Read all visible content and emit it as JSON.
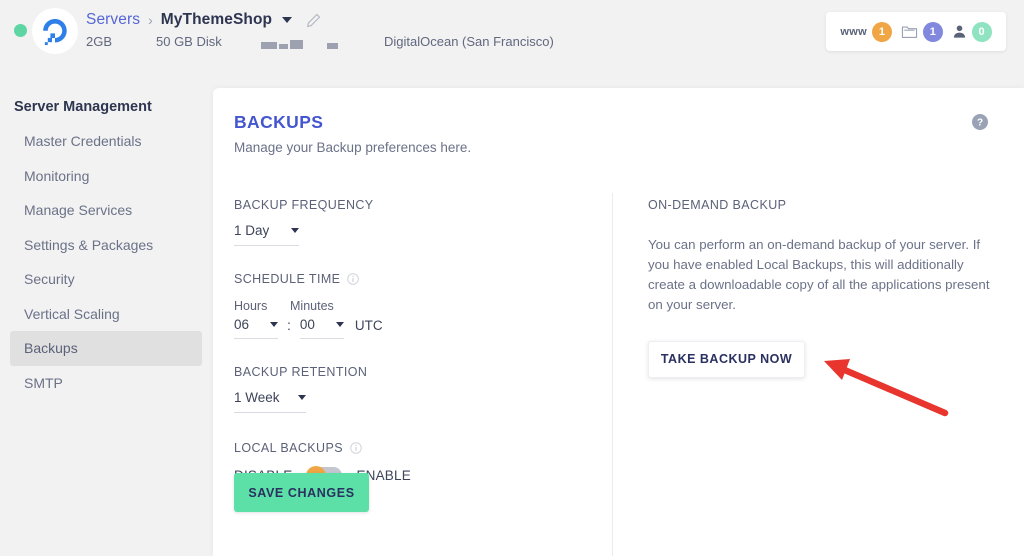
{
  "header": {
    "status_dot_color": "#5ed6a4",
    "logo_icon": "digitalocean-logo-icon",
    "breadcrumb_root": "Servers",
    "breadcrumb_separator": "›",
    "server_name": "MyThemeShop",
    "dropdown_icon": "chevron-down-icon",
    "edit_icon": "pencil-icon",
    "ram": "2GB",
    "disk": "50 GB Disk",
    "ip_redacted": "███",
    "ip_private_redacted": "█",
    "provider": "DigitalOcean (San Francisco)",
    "badges": [
      {
        "name": "www",
        "icon": "www-text-icon",
        "label": "www",
        "count": "1",
        "color": "#f0a644"
      },
      {
        "name": "folder",
        "icon": "folder-icon",
        "label": "",
        "count": "1",
        "color": "#8188dd"
      },
      {
        "name": "user",
        "icon": "person-icon",
        "label": "",
        "count": "0",
        "color": "#8fe3c0"
      }
    ]
  },
  "sidebar": {
    "title": "Server Management",
    "items": [
      {
        "label": "Master Credentials",
        "active": false
      },
      {
        "label": "Monitoring",
        "active": false
      },
      {
        "label": "Manage Services",
        "active": false
      },
      {
        "label": "Settings & Packages",
        "active": false
      },
      {
        "label": "Security",
        "active": false
      },
      {
        "label": "Vertical Scaling",
        "active": false
      },
      {
        "label": "Backups",
        "active": true
      },
      {
        "label": "SMTP",
        "active": false
      }
    ]
  },
  "main": {
    "title": "BACKUPS",
    "subtitle": "Manage your Backup preferences here.",
    "help_icon": "help-circle-icon",
    "title_color": "#4356cf",
    "left": {
      "frequency_label": "BACKUP FREQUENCY",
      "frequency_value": "1 Day",
      "schedule_label": "SCHEDULE TIME",
      "schedule_info_icon": "info-icon",
      "hours_label": "Hours",
      "minutes_label": "Minutes",
      "hours_value": "06",
      "minutes_separator": ":",
      "minutes_value": "00",
      "timezone": "UTC",
      "retention_label": "BACKUP RETENTION",
      "retention_value": "1 Week",
      "local_backups_label": "LOCAL BACKUPS",
      "local_backups_info_icon": "info-icon",
      "toggle_off_label": "DISABLE",
      "toggle_on_label": "ENABLE",
      "toggle_state": "disabled",
      "toggle_knob_color": "#f0a644",
      "save_label": "SAVE CHANGES",
      "save_color": "#5ce0a8"
    },
    "right": {
      "title": "ON-DEMAND BACKUP",
      "body": "You can perform an on-demand backup of your server. If you have enabled Local Backups, this will additionally create a downloadable copy of all the applications present on your server.",
      "button_label": "TAKE BACKUP NOW"
    }
  },
  "annotation": {
    "arrow_color": "#e8352e",
    "arrow_name": "red-arrow-pointing-to-take-backup-now"
  }
}
